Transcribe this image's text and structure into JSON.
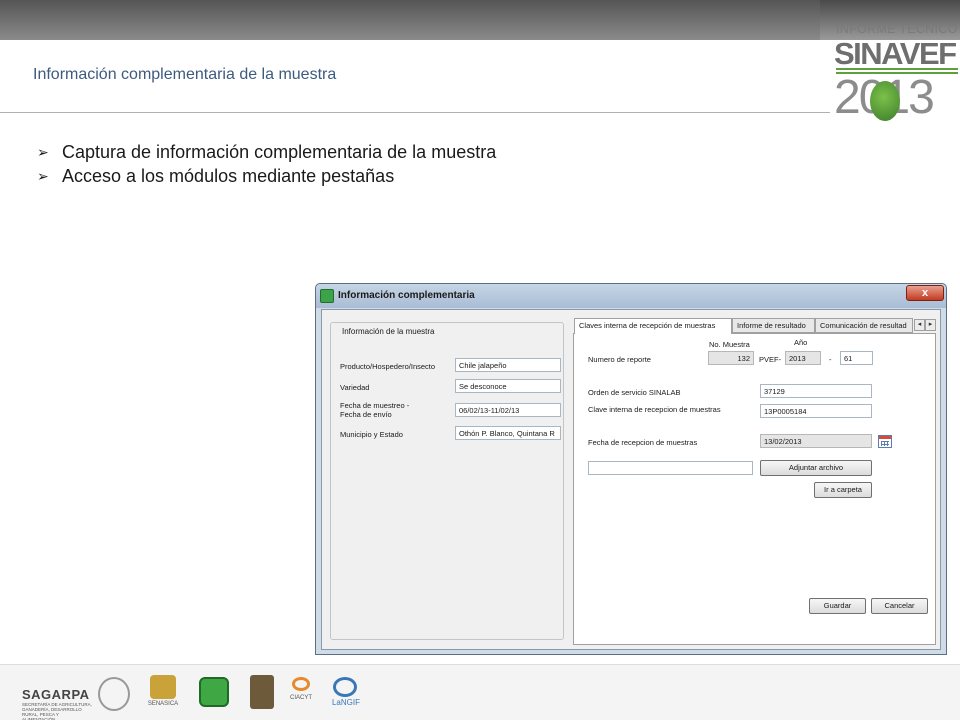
{
  "slide": {
    "title": "Información complementaria de la muestra",
    "brand_subtitle": "INFORME TECNICO",
    "brand_name": "SINAVEF",
    "brand_year": "2013",
    "bullets": [
      "Captura de información complementaria de la muestra",
      "Acceso a los módulos mediante pestañas"
    ]
  },
  "window": {
    "title": "Información complementaria",
    "close_label": "x"
  },
  "sample_info": {
    "group_title": "Información de la muestra",
    "product_label": "Producto/Hospedero/Insecto",
    "product_value": "Chile jalapeño",
    "variety_label": "Variedad",
    "variety_value": "Se desconoce",
    "dates_label_line1": "Fecha de muestreo -",
    "dates_label_line2": "Fecha de envío",
    "dates_value": "06/02/13-11/02/13",
    "municipality_label": "Municipio y Estado",
    "municipality_value": "Othón P. Blanco, Quintana R"
  },
  "tabs": [
    {
      "label": "Claves interna de recepción de muestras"
    },
    {
      "label": "Informe de resultado"
    },
    {
      "label": "Comunicación de resultad"
    }
  ],
  "tab_scroll": {
    "left": "◂",
    "right": "▸"
  },
  "reception": {
    "sample_no_header": "No. Muestra",
    "year_header": "Año",
    "report_label": "Numero de reporte",
    "sample_no_value": "132",
    "prefix": "PVEF-",
    "year_value": "2013",
    "dash": "-",
    "report_seq": "61",
    "order_label": "Orden de servicio SINALAB",
    "order_value": "37129",
    "internal_key_label": "Clave interna de recepcion de muestras",
    "internal_key_value": "13P0005184",
    "reception_date_label": "Fecha de recepcion de muestras",
    "reception_date_value": "13/02/2013",
    "file_path_value": "",
    "attach_button": "Adjuntar archivo",
    "folder_button": "Ir a carpeta"
  },
  "actions": {
    "save": "Guardar",
    "cancel": "Cancelar"
  },
  "footer": {
    "sagarpa": "SAGARPA",
    "sagarpa_sub": "SECRETARÍA DE AGRICULTURA, GANADERÍA, DESARROLLO RURAL, PESCA Y ALIMENTACIÓN",
    "senasica": "SENASICA",
    "ciacyt": "CIACYT",
    "langif": "LaNGIF"
  },
  "colors": {
    "title_text": "#3d5a80",
    "brand_green": "#5f9f3e",
    "window_frame": "#cfdbe7",
    "close_button": "#c23b22"
  }
}
